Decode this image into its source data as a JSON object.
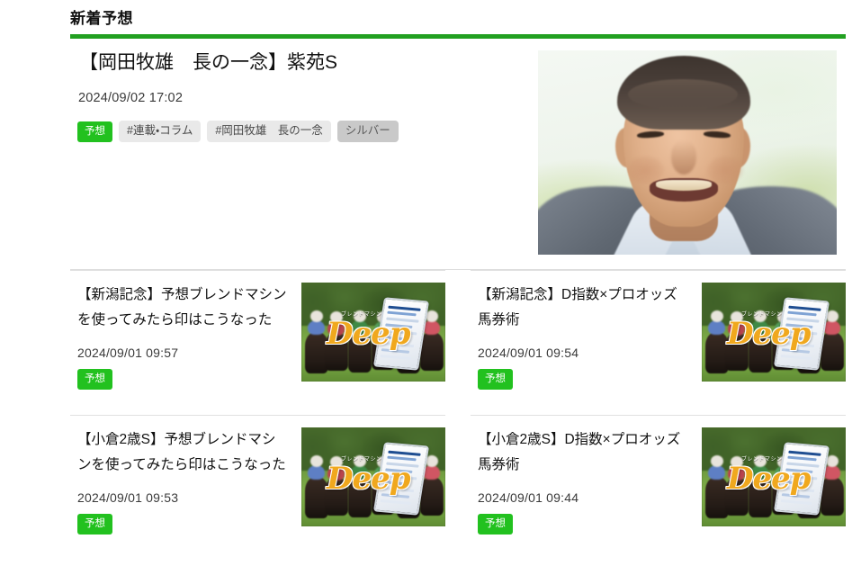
{
  "section": {
    "heading": "新着予想",
    "accent_color": "#22a021"
  },
  "featured": {
    "title": "【岡田牧雄　長の一念】紫苑S",
    "date": "2024/09/02 17:02",
    "badge": "予想",
    "badge_color": "#22c11f",
    "tags": [
      {
        "label": "#連載・コラム",
        "style": "light"
      },
      {
        "label": "#岡田牧雄　長の一念",
        "style": "light"
      },
      {
        "label": "シルバー",
        "style": "dark"
      }
    ],
    "image_alt": "岡田牧雄-portrait-photo"
  },
  "articles": [
    {
      "title": "【新潟記念】予想ブレンドマシンを使ってみたら印はこうなった",
      "date": "2024/09/01 09:57",
      "badge": "予想",
      "thumb_logo": "Deep",
      "thumb_sub": "ブレンドマシン",
      "image_alt": "deep-horse-racing-thumbnail"
    },
    {
      "title": "【新潟記念】D指数×プロオッズ馬券術",
      "date": "2024/09/01 09:54",
      "badge": "予想",
      "thumb_logo": "Deep",
      "thumb_sub": "ブレンドマシン",
      "image_alt": "deep-horse-racing-thumbnail"
    },
    {
      "title": "【小倉2歳S】予想ブレンドマシンを使ってみたら印はこうなった",
      "date": "2024/09/01 09:53",
      "badge": "予想",
      "thumb_logo": "Deep",
      "thumb_sub": "ブレンドマシン",
      "image_alt": "deep-horse-racing-thumbnail"
    },
    {
      "title": "【小倉2歳S】D指数×プロオッズ馬券術",
      "date": "2024/09/01 09:44",
      "badge": "予想",
      "thumb_logo": "Deep",
      "thumb_sub": "ブレンドマシン",
      "image_alt": "deep-horse-racing-thumbnail"
    }
  ]
}
